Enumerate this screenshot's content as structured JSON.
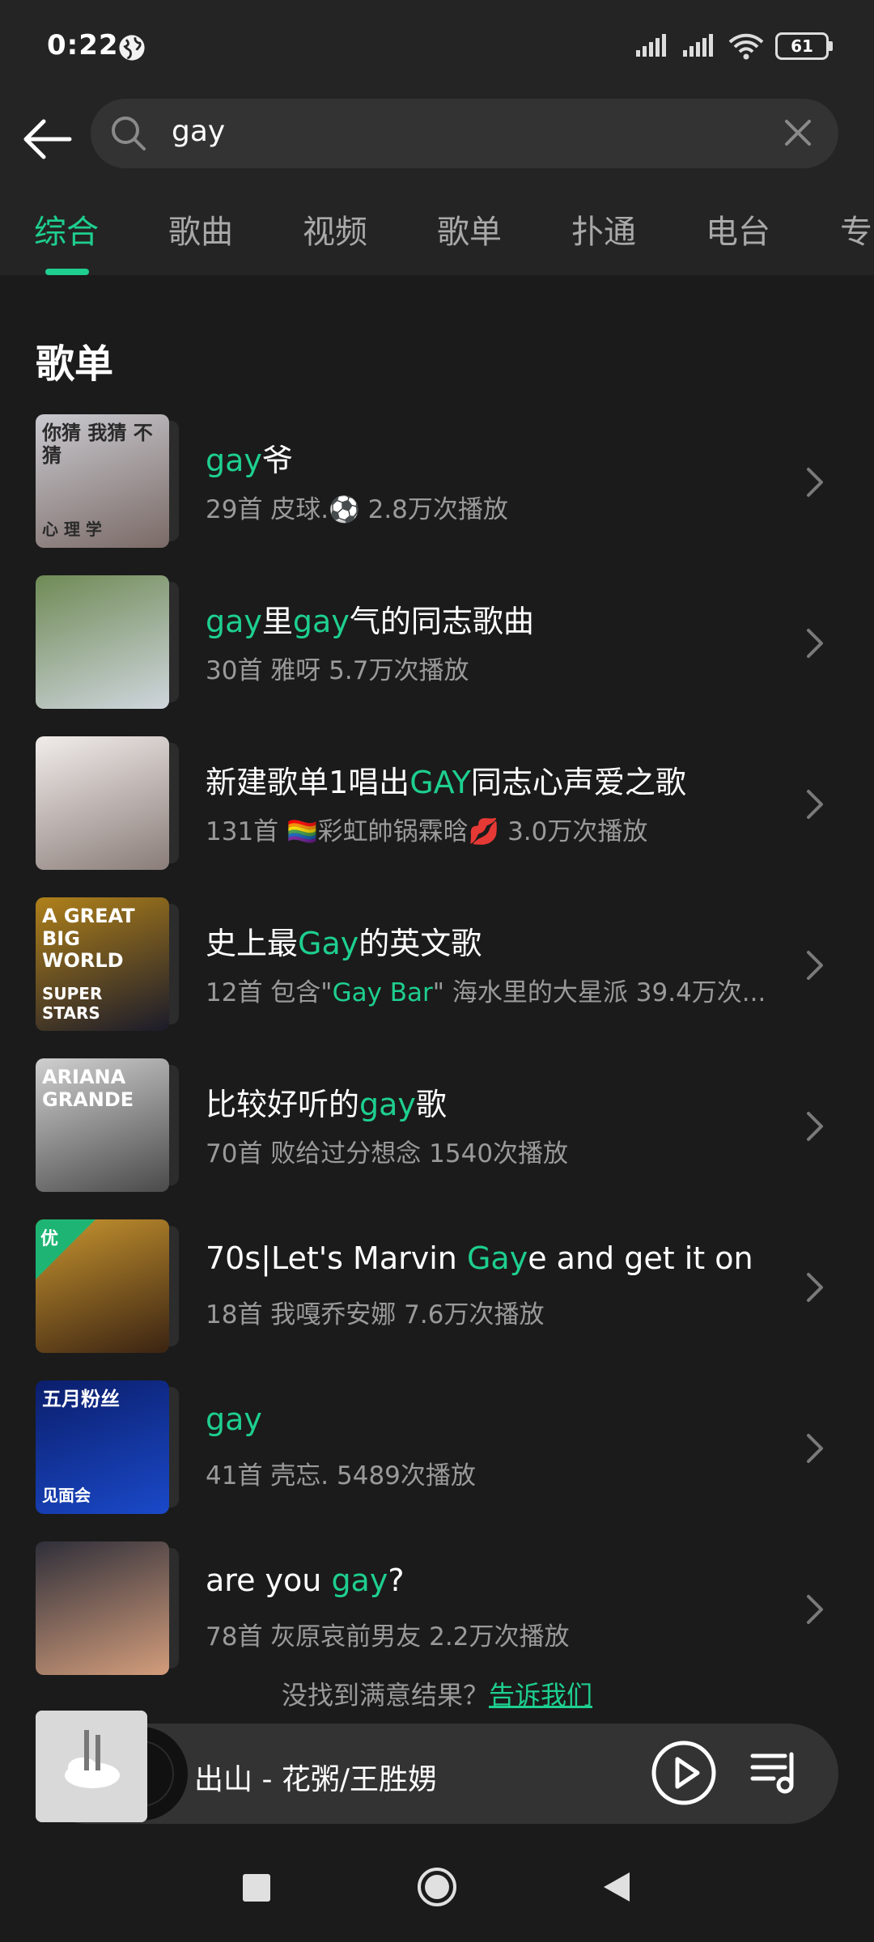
{
  "status": {
    "time": "0:22",
    "battery": "61"
  },
  "search": {
    "query": "gay"
  },
  "tabs": [
    "综合",
    "歌曲",
    "视频",
    "歌单",
    "扑通",
    "电台",
    "专"
  ],
  "section_title": "歌单",
  "playlists": [
    {
      "title_parts": [
        {
          "t": "gay",
          "h": true
        },
        {
          "t": "爷",
          "h": false
        }
      ],
      "meta_parts": [
        {
          "t": "29首  皮球.⚽  2.8万次播放",
          "h": false
        }
      ]
    },
    {
      "title_parts": [
        {
          "t": "gay",
          "h": true
        },
        {
          "t": "里",
          "h": false
        },
        {
          "t": "gay",
          "h": true
        },
        {
          "t": "气的同志歌曲",
          "h": false
        }
      ],
      "meta_parts": [
        {
          "t": "30首  雅呀  5.7万次播放",
          "h": false
        }
      ]
    },
    {
      "title_parts": [
        {
          "t": "新建歌单1唱出",
          "h": false
        },
        {
          "t": "GAY",
          "h": true
        },
        {
          "t": "同志心声爱之歌",
          "h": false
        }
      ],
      "meta_parts": [
        {
          "t": "131首  🏳️‍🌈彩虹帥锅霖晗💋  3.0万次播放",
          "h": false
        }
      ]
    },
    {
      "title_parts": [
        {
          "t": "史上最",
          "h": false
        },
        {
          "t": "Gay",
          "h": true
        },
        {
          "t": "的英文歌",
          "h": false
        }
      ],
      "meta_parts": [
        {
          "t": "12首  包含\"",
          "h": false
        },
        {
          "t": "Gay Bar",
          "h": true
        },
        {
          "t": "\" 海水里的大星派  39.4万次...",
          "h": false
        }
      ]
    },
    {
      "title_parts": [
        {
          "t": "比较好听的",
          "h": false
        },
        {
          "t": "gay",
          "h": true
        },
        {
          "t": "歌",
          "h": false
        }
      ],
      "meta_parts": [
        {
          "t": "70首  败给过分想念  1540次播放",
          "h": false
        }
      ]
    },
    {
      "title_parts": [
        {
          "t": "70s|Let's Marvin ",
          "h": false
        },
        {
          "t": "Gay",
          "h": true
        },
        {
          "t": "e and get it on",
          "h": false
        }
      ],
      "meta_parts": [
        {
          "t": "18首  我嘎乔安娜  7.6万次播放",
          "h": false
        }
      ],
      "badge": "优"
    },
    {
      "title_parts": [
        {
          "t": "gay",
          "h": true
        }
      ],
      "meta_parts": [
        {
          "t": "41首  壳忘.  5489次播放",
          "h": false
        }
      ]
    },
    {
      "title_parts": [
        {
          "t": "are you ",
          "h": false
        },
        {
          "t": "gay",
          "h": true
        },
        {
          "t": "?",
          "h": false
        }
      ],
      "meta_parts": [
        {
          "t": "78首  灰原哀前男友  2.2万次播放",
          "h": false
        }
      ]
    }
  ],
  "covers": [
    {
      "c1": "#c9c9cf",
      "c2": "#7a6a66",
      "text": "你猜 我猜 不猜",
      "text2": "心 理 学",
      "fg": "#2a2a2a"
    },
    {
      "c1": "#6f8a55",
      "c2": "#cfd6dd",
      "text": "",
      "text2": "",
      "fg": "#fff"
    },
    {
      "c1": "#f1ecea",
      "c2": "#8a7d79",
      "text": "",
      "text2": "",
      "fg": "#fff"
    },
    {
      "c1": "#b0811a",
      "c2": "#1b1b2a",
      "text": "A GREAT BIG WORLD",
      "text2": "SUPER STARS",
      "fg": "#fff"
    },
    {
      "c1": "#cfcfcf",
      "c2": "#4a4a4a",
      "text": "ARIANA GRANDE",
      "text2": "",
      "fg": "#fff"
    },
    {
      "c1": "#c8952f",
      "c2": "#3a2312",
      "text": "",
      "text2": "",
      "fg": "#fff"
    },
    {
      "c1": "#0b1e6b",
      "c2": "#1a49c9",
      "text": "五月粉丝",
      "text2": "见面会",
      "fg": "#fff"
    },
    {
      "c1": "#2f2f3a",
      "c2": "#d39d7b",
      "text": "",
      "text2": "",
      "fg": "#fff"
    }
  ],
  "footer": {
    "hint": "没找到满意结果？",
    "link": "告诉我们"
  },
  "player": {
    "title": "出山 - 花粥/王胜娚"
  },
  "colors": {
    "accent": "#1ecf8f",
    "background": "#1b1b1b",
    "header": "#242424"
  }
}
